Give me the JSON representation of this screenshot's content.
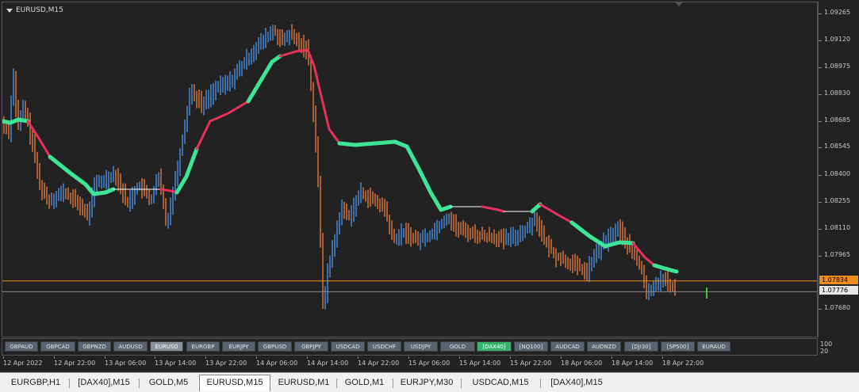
{
  "chart": {
    "title": "EURUSD,M15",
    "symbol": "EURUSD",
    "timeframe": "M15"
  },
  "price_axis": {
    "labels": [
      "1.09265",
      "1.09120",
      "1.08975",
      "1.08830",
      "1.08685",
      "1.08545",
      "1.08400",
      "1.08255",
      "1.08110",
      "1.07965",
      "1.07680"
    ],
    "bid": "1.07834",
    "ask": "1.07776",
    "bid_color": "#f08c1c",
    "ask_color": "#e6e6e6"
  },
  "time_axis": {
    "labels": [
      "12 Apr 2022",
      "12 Apr 22:00",
      "13 Apr 06:00",
      "13 Apr 14:00",
      "13 Apr 22:00",
      "14 Apr 06:00",
      "14 Apr 14:00",
      "14 Apr 22:00",
      "15 Apr 06:00",
      "15 Apr 14:00",
      "15 Apr 22:00",
      "18 Apr 06:00",
      "18 Apr 14:00",
      "18 Apr 22:00"
    ]
  },
  "symbol_buttons": [
    {
      "label": "GBPAUD",
      "state": "normal"
    },
    {
      "label": "GBPCAD",
      "state": "normal"
    },
    {
      "label": "GBPNZD",
      "state": "normal"
    },
    {
      "label": "AUDUSD",
      "state": "normal"
    },
    {
      "label": "EURUSD",
      "state": "active"
    },
    {
      "label": "EURGBP",
      "state": "normal"
    },
    {
      "label": "EURJPY",
      "state": "normal"
    },
    {
      "label": "GBPUSD",
      "state": "normal"
    },
    {
      "label": "GBPJPY",
      "state": "normal"
    },
    {
      "label": "USDCAD",
      "state": "normal"
    },
    {
      "label": "USDCHF",
      "state": "normal"
    },
    {
      "label": "USDJPY",
      "state": "normal"
    },
    {
      "label": "GOLD",
      "state": "normal"
    },
    {
      "label": "[DAX40]",
      "state": "green"
    },
    {
      "label": "[NQ100]",
      "state": "normal"
    },
    {
      "label": "AUDCAD",
      "state": "normal"
    },
    {
      "label": "AUDNZD",
      "state": "normal"
    },
    {
      "label": "[DJI30]",
      "state": "normal"
    },
    {
      "label": "[SP500]",
      "state": "normal"
    },
    {
      "label": "EURAUD",
      "state": "normal"
    }
  ],
  "sub_scale": {
    "top": "100",
    "bottom": "20"
  },
  "tabs": [
    {
      "label": "EURGBP,H1",
      "active": false
    },
    {
      "label": "[DAX40],M15",
      "active": false
    },
    {
      "label": "GOLD,M5",
      "active": false
    },
    {
      "label": "EURUSD,M15",
      "active": true
    },
    {
      "label": "EURUSD,M1",
      "active": false
    },
    {
      "label": "GOLD,M1",
      "active": false
    },
    {
      "label": "EURJPY,M30",
      "active": false
    },
    {
      "label": "USDCAD,M15",
      "active": false
    },
    {
      "label": "[DAX40],M15",
      "active": false
    }
  ],
  "colors": {
    "bull_candle": "#4a90e2",
    "bear_candle": "#e0783c",
    "ma_up": "#3ce696",
    "ma_down": "#e6325a",
    "ma_flat": "#ffffff",
    "bid_line": "#f08c1c",
    "ask_line": "#8a8a8a"
  }
}
